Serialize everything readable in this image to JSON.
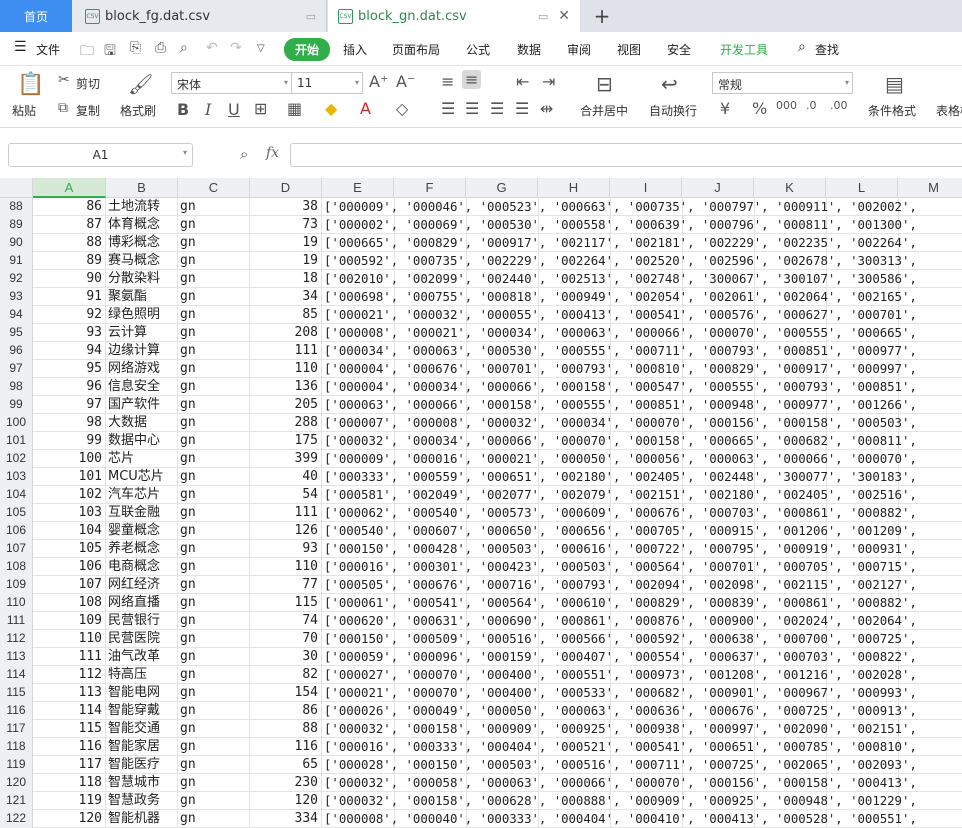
{
  "tabs": {
    "home": "首页",
    "docs": [
      {
        "title": "block_fg.dat.csv",
        "icon": "CSV"
      },
      {
        "title": "block_gn.dat.csv",
        "icon": "CSV"
      }
    ]
  },
  "menu": {
    "file": "文件",
    "items": [
      "开始",
      "插入",
      "页面布局",
      "公式",
      "数据",
      "审阅",
      "视图",
      "安全",
      "开发工具"
    ],
    "search": "查找"
  },
  "ribbon": {
    "paste": "粘贴",
    "cut": "剪切",
    "copy": "复制",
    "format_painter": "格式刷",
    "font_name": "宋体",
    "font_size": "11",
    "merge": "合并居中",
    "wrap": "自动换行",
    "number_format": "常规",
    "cond_format": "条件格式",
    "table_style": "表格样"
  },
  "formula_bar": {
    "name_box": "A1",
    "fx": "fx",
    "content": ""
  },
  "columns": [
    "A",
    "B",
    "C",
    "D",
    "E",
    "F",
    "G",
    "H",
    "I",
    "J",
    "K",
    "L",
    "M"
  ],
  "rows": [
    {
      "n": "88",
      "a": "86",
      "b": "土地流转",
      "c": "gn",
      "d": "38",
      "e": "['000009', '000046', '000523', '000663', '000735', '000797', '000911', '002002',"
    },
    {
      "n": "89",
      "a": "87",
      "b": "体育概念",
      "c": "gn",
      "d": "73",
      "e": "['000002', '000069', '000530', '000558', '000639', '000796', '000811', '001300',"
    },
    {
      "n": "90",
      "a": "88",
      "b": "博彩概念",
      "c": "gn",
      "d": "19",
      "e": "['000665', '000829', '000917', '002117', '002181', '002229', '002235', '002264',"
    },
    {
      "n": "91",
      "a": "89",
      "b": "赛马概念",
      "c": "gn",
      "d": "19",
      "e": "['000592', '000735', '002229', '002264', '002520', '002596', '002678', '300313',"
    },
    {
      "n": "92",
      "a": "90",
      "b": "分散染料",
      "c": "gn",
      "d": "18",
      "e": "['002010', '002099', '002440', '002513', '002748', '300067', '300107', '300586',"
    },
    {
      "n": "93",
      "a": "91",
      "b": "聚氨酯",
      "c": "gn",
      "d": "34",
      "e": "['000698', '000755', '000818', '000949', '002054', '002061', '002064', '002165',"
    },
    {
      "n": "94",
      "a": "92",
      "b": "绿色照明",
      "c": "gn",
      "d": "85",
      "e": "['000021', '000032', '000055', '000413', '000541', '000576', '000627', '000701',"
    },
    {
      "n": "95",
      "a": "93",
      "b": "云计算",
      "c": "gn",
      "d": "208",
      "e": "['000008', '000021', '000034', '000063', '000066', '000070', '000555', '000665',"
    },
    {
      "n": "96",
      "a": "94",
      "b": "边缘计算",
      "c": "gn",
      "d": "111",
      "e": "['000034', '000063', '000530', '000555', '000711', '000793', '000851', '000977',"
    },
    {
      "n": "97",
      "a": "95",
      "b": "网络游戏",
      "c": "gn",
      "d": "110",
      "e": "['000004', '000676', '000701', '000793', '000810', '000829', '000917', '000997',"
    },
    {
      "n": "98",
      "a": "96",
      "b": "信息安全",
      "c": "gn",
      "d": "136",
      "e": "['000004', '000034', '000066', '000158', '000547', '000555', '000793', '000851',"
    },
    {
      "n": "99",
      "a": "97",
      "b": "国产软件",
      "c": "gn",
      "d": "205",
      "e": "['000063', '000066', '000158', '000555', '000851', '000948', '000977', '001266',"
    },
    {
      "n": "100",
      "a": "98",
      "b": "大数据",
      "c": "gn",
      "d": "288",
      "e": "['000007', '000008', '000032', '000034', '000070', '000156', '000158', '000503',"
    },
    {
      "n": "101",
      "a": "99",
      "b": "数据中心",
      "c": "gn",
      "d": "175",
      "e": "['000032', '000034', '000066', '000070', '000158', '000665', '000682', '000811',"
    },
    {
      "n": "102",
      "a": "100",
      "b": "芯片",
      "c": "gn",
      "d": "399",
      "e": "['000009', '000016', '000021', '000050', '000056', '000063', '000066', '000070',"
    },
    {
      "n": "103",
      "a": "101",
      "b": "MCU芯片",
      "c": "gn",
      "d": "40",
      "e": "['000333', '000559', '000651', '002180', '002405', '002448', '300077', '300183',"
    },
    {
      "n": "104",
      "a": "102",
      "b": "汽车芯片",
      "c": "gn",
      "d": "54",
      "e": "['000581', '002049', '002077', '002079', '002151', '002180', '002405', '002516',"
    },
    {
      "n": "105",
      "a": "103",
      "b": "互联金融",
      "c": "gn",
      "d": "111",
      "e": "['000062', '000540', '000573', '000609', '000676', '000703', '000861', '000882',"
    },
    {
      "n": "106",
      "a": "104",
      "b": "婴童概念",
      "c": "gn",
      "d": "126",
      "e": "['000540', '000607', '000650', '000656', '000705', '000915', '001206', '001209',"
    },
    {
      "n": "107",
      "a": "105",
      "b": "养老概念",
      "c": "gn",
      "d": "93",
      "e": "['000150', '000428', '000503', '000616', '000722', '000795', '000919', '000931',"
    },
    {
      "n": "108",
      "a": "106",
      "b": "电商概念",
      "c": "gn",
      "d": "110",
      "e": "['000016', '000301', '000423', '000503', '000564', '000701', '000705', '000715',"
    },
    {
      "n": "109",
      "a": "107",
      "b": "网红经济",
      "c": "gn",
      "d": "77",
      "e": "['000505', '000676', '000716', '000793', '002094', '002098', '002115', '002127',"
    },
    {
      "n": "110",
      "a": "108",
      "b": "网络直播",
      "c": "gn",
      "d": "115",
      "e": "['000061', '000541', '000564', '000610', '000829', '000839', '000861', '000882',"
    },
    {
      "n": "111",
      "a": "109",
      "b": "民营银行",
      "c": "gn",
      "d": "74",
      "e": "['000620', '000631', '000690', '000861', '000876', '000900', '002024', '002064',"
    },
    {
      "n": "112",
      "a": "110",
      "b": "民营医院",
      "c": "gn",
      "d": "70",
      "e": "['000150', '000509', '000516', '000566', '000592', '000638', '000700', '000725',"
    },
    {
      "n": "113",
      "a": "111",
      "b": "油气改革",
      "c": "gn",
      "d": "30",
      "e": "['000059', '000096', '000159', '000407', '000554', '000637', '000703', '000822',"
    },
    {
      "n": "114",
      "a": "112",
      "b": "特高压",
      "c": "gn",
      "d": "82",
      "e": "['000027', '000070', '000400', '000551', '000973', '001208', '001216', '002028',"
    },
    {
      "n": "115",
      "a": "113",
      "b": "智能电网",
      "c": "gn",
      "d": "154",
      "e": "['000021', '000070', '000400', '000533', '000682', '000901', '000967', '000993',"
    },
    {
      "n": "116",
      "a": "114",
      "b": "智能穿戴",
      "c": "gn",
      "d": "86",
      "e": "['000026', '000049', '000050', '000063', '000636', '000676', '000725', '000913',"
    },
    {
      "n": "117",
      "a": "115",
      "b": "智能交通",
      "c": "gn",
      "d": "88",
      "e": "['000032', '000158', '000909', '000925', '000938', '000997', '002090', '002151',"
    },
    {
      "n": "118",
      "a": "116",
      "b": "智能家居",
      "c": "gn",
      "d": "116",
      "e": "['000016', '000333', '000404', '000521', '000541', '000651', '000785', '000810',"
    },
    {
      "n": "119",
      "a": "117",
      "b": "智能医疗",
      "c": "gn",
      "d": "65",
      "e": "['000028', '000150', '000503', '000516', '000711', '000725', '002065', '002093',"
    },
    {
      "n": "120",
      "a": "118",
      "b": "智慧城市",
      "c": "gn",
      "d": "230",
      "e": "['000032', '000058', '000063', '000066', '000070', '000156', '000158', '000413',"
    },
    {
      "n": "121",
      "a": "119",
      "b": "智慧政务",
      "c": "gn",
      "d": "120",
      "e": "['000032', '000158', '000628', '000888', '000909', '000925', '000948', '001229',"
    },
    {
      "n": "122",
      "a": "120",
      "b": "智能机器",
      "c": "gn",
      "d": "334",
      "e": "['000008', '000040', '000333', '000404', '000410', '000413', '000528', '000551',"
    }
  ]
}
